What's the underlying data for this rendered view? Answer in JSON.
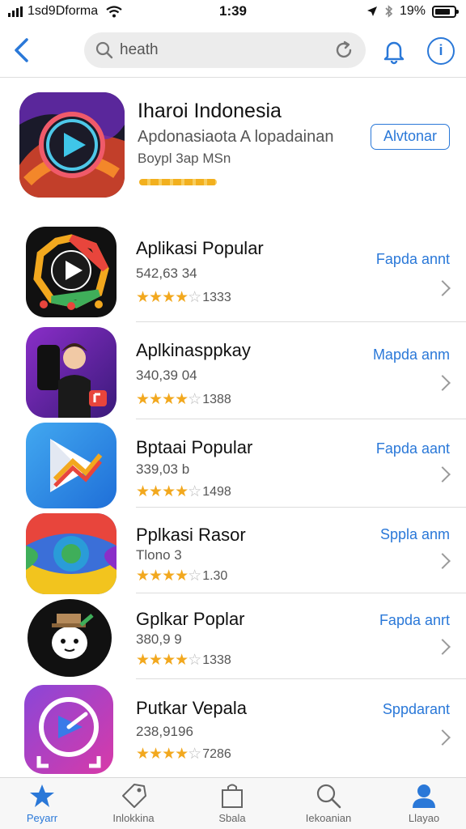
{
  "status_bar": {
    "carrier": "1sd9Dforma",
    "time": "1:39",
    "battery": "19%"
  },
  "search": {
    "query": "heath"
  },
  "featured": {
    "title": "Iharoi Indonesia",
    "subtitle": "Apdonasiaota A lopadainan",
    "subtitle2": "Boypl 3ap MSn",
    "button": "Alvtonar"
  },
  "apps": [
    {
      "name": "Aplikasi Popular",
      "meta": "542,63 34",
      "rating_text": "1333",
      "stars": 4,
      "action": "Fapda annt"
    },
    {
      "name": "Aplkinasppkay",
      "meta": "340,39 04",
      "rating_text": "1388",
      "stars": 4,
      "action": "Mapda anm"
    },
    {
      "name": "Bptaai Popular",
      "meta": "339,03 b",
      "rating_text": "1498",
      "stars": 4,
      "action": "Fapda aant"
    },
    {
      "name": "Pplkasi Rasor",
      "meta": "Tlono 3",
      "rating_text": "1.30",
      "stars": 4,
      "action": "Sppla anm"
    },
    {
      "name": "Gplkar Poplar",
      "meta": "380,9 9",
      "rating_text": "1338",
      "stars": 4,
      "action": "Fapda anrt"
    },
    {
      "name": "Putkar Vepala",
      "meta": "238,9196",
      "rating_text": "7286",
      "stars": 4,
      "action": "Sppdarant"
    }
  ],
  "tabs": [
    {
      "label": "Peyarr"
    },
    {
      "label": "Inlokkina"
    },
    {
      "label": "Sbala"
    },
    {
      "label": "Iekoanian"
    },
    {
      "label": "Llayao"
    }
  ],
  "colors": {
    "accent": "#2a78d8",
    "star": "#f2a81e"
  }
}
